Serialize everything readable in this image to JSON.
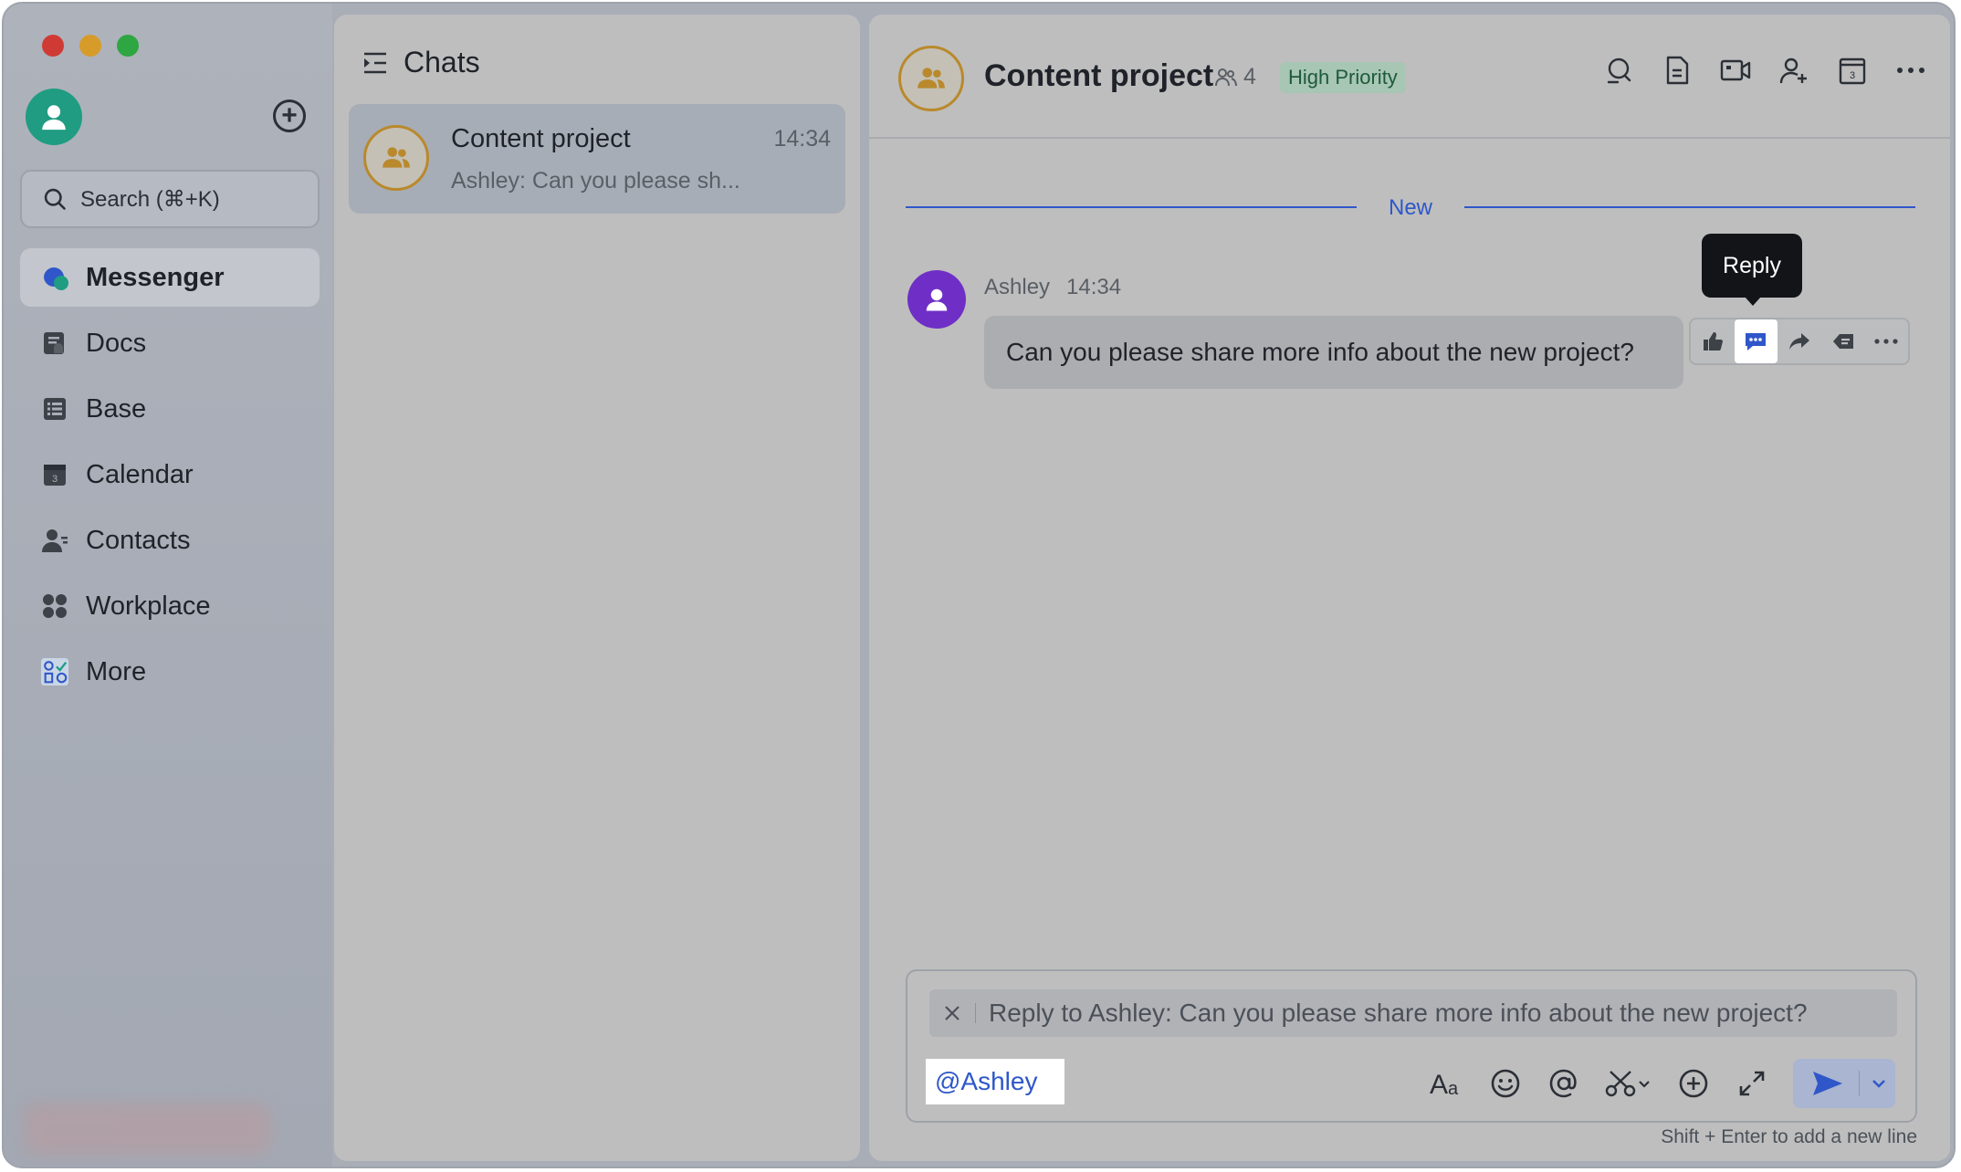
{
  "window": {
    "traffic_lights": [
      "close",
      "minimize",
      "zoom"
    ]
  },
  "rail": {
    "search_placeholder": "Search (⌘+K)",
    "nav": [
      {
        "id": "messenger",
        "label": "Messenger",
        "icon": "messenger-icon",
        "active": true
      },
      {
        "id": "docs",
        "label": "Docs",
        "icon": "docs-icon"
      },
      {
        "id": "base",
        "label": "Base",
        "icon": "base-icon"
      },
      {
        "id": "calendar",
        "label": "Calendar",
        "icon": "calendar-icon"
      },
      {
        "id": "contacts",
        "label": "Contacts",
        "icon": "contacts-icon"
      },
      {
        "id": "workplace",
        "label": "Workplace",
        "icon": "workplace-icon"
      },
      {
        "id": "more",
        "label": "More",
        "icon": "more-apps-icon"
      }
    ]
  },
  "chatlist": {
    "title": "Chats",
    "items": [
      {
        "name": "Content project",
        "time": "14:34",
        "preview": "Ashley: Can you please sh..."
      }
    ]
  },
  "conversation": {
    "title": "Content project",
    "member_count": "4",
    "tag": "High Priority",
    "divider_label": "New",
    "message": {
      "sender": "Ashley",
      "time": "14:34",
      "text": "Can you please share more info about the new project?"
    },
    "tooltip": "Reply",
    "composer": {
      "reply_banner": "Reply to Ashley: Can you please share more info about the new project?",
      "mention": "@Ashley",
      "hint": "Shift + Enter to add a new line"
    }
  },
  "colors": {
    "accent": "#2f57c9",
    "avatar_me": "#1f9c82",
    "avatar_ashley": "#6f2fc6",
    "group_ring": "#b9892c",
    "priority_bg": "#a7c6b3"
  }
}
